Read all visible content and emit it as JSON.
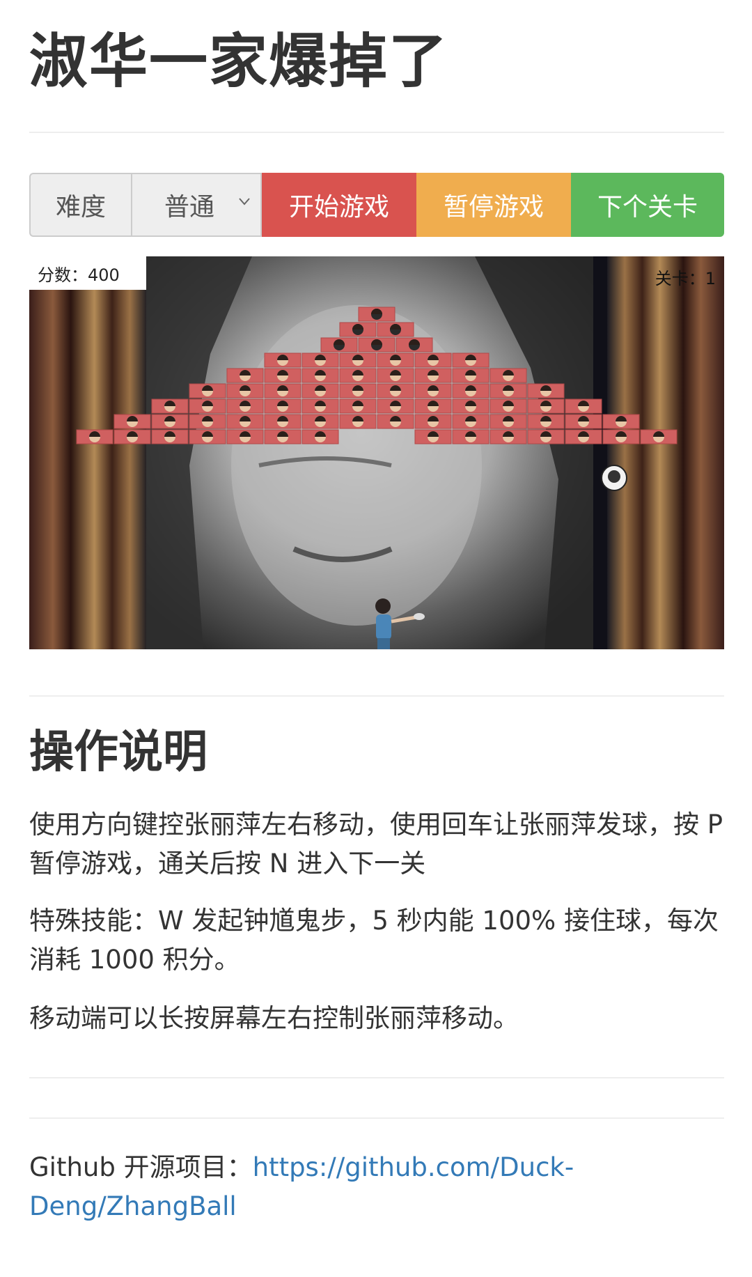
{
  "page": {
    "title": "淑华一家爆掉了"
  },
  "toolbar": {
    "difficulty_label": "难度",
    "difficulty_value": "普通",
    "start_label": "开始游戏",
    "pause_label": "暂停游戏",
    "next_label": "下个关卡",
    "colors": {
      "start": "#d9534f",
      "pause": "#f0ad4e",
      "next": "#5cb85c"
    }
  },
  "game": {
    "score_text": "分数：400",
    "level_text": "关卡：1",
    "brick_color": "#d06060",
    "icons": [
      "ball-icon",
      "player-figure-icon",
      "brick-face-icon"
    ]
  },
  "instructions": {
    "heading": "操作说明",
    "p1": "使用方向键控张丽萍左右移动，使用回车让张丽萍发球，按 P 暂停游戏，通关后按 N 进入下一关",
    "p2": "特殊技能：W 发起钟馗鬼步，5 秒内能 100% 接住球，每次消耗 1000 积分。",
    "p3": "移动端可以长按屏幕左右控制张丽萍移动。"
  },
  "footer": {
    "prefix": "Github 开源项目：",
    "link_text": "https://github.com/Duck-Deng/ZhangBall"
  }
}
